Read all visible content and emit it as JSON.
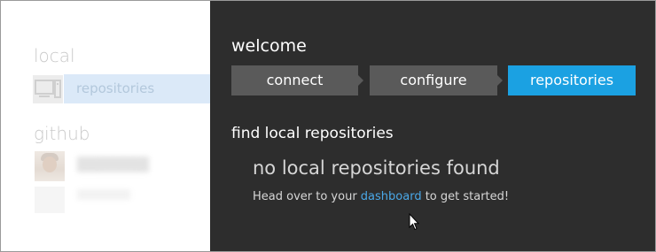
{
  "sidebar": {
    "local_title": "local",
    "local_items": [
      {
        "label": "repositories",
        "icon": "computer-icon",
        "selected": true
      }
    ],
    "github_title": "github",
    "github_items": [
      {
        "label": "",
        "icon": "avatar",
        "blurred": true
      }
    ]
  },
  "main": {
    "title": "welcome",
    "steps": [
      {
        "label": "connect",
        "active": false
      },
      {
        "label": "configure",
        "active": false
      },
      {
        "label": "repositories",
        "active": true
      }
    ],
    "section_title": "find local repositories",
    "empty_state": {
      "heading": "no local repositories found",
      "message_before": "Head over to your ",
      "link_text": "dashboard",
      "message_after": " to get started!"
    }
  },
  "colors": {
    "accent": "#1ba1e2",
    "panel_bg": "#2d2d2d",
    "step_inactive": "#5a5a5a",
    "link": "#4aa8e8",
    "selection_bg": "#dbe9f8"
  }
}
